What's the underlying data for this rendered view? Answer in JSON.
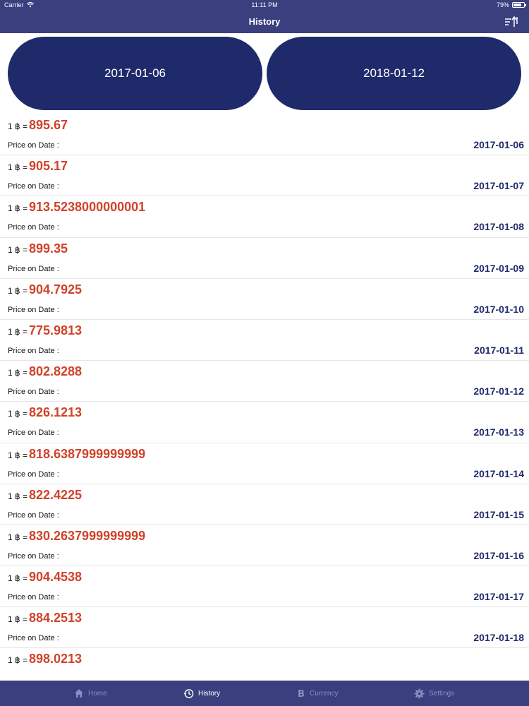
{
  "status_bar": {
    "carrier": "Carrier",
    "time": "11:11 PM",
    "battery": "79%"
  },
  "nav": {
    "title": "History",
    "sort_icon": "sort-icon"
  },
  "date_range": {
    "start": "2017-01-06",
    "end": "2018-01-12"
  },
  "rate_prefix": "1 ฿ =",
  "price_label": "Price on Date :",
  "rows": [
    {
      "value": "895.67",
      "date": "2017-01-06"
    },
    {
      "value": "905.17",
      "date": "2017-01-07"
    },
    {
      "value": "913.5238000000001",
      "date": "2017-01-08"
    },
    {
      "value": "899.35",
      "date": "2017-01-09"
    },
    {
      "value": "904.7925",
      "date": "2017-01-10"
    },
    {
      "value": "775.9813",
      "date": "2017-01-11"
    },
    {
      "value": "802.8288",
      "date": "2017-01-12"
    },
    {
      "value": "826.1213",
      "date": "2017-01-13"
    },
    {
      "value": "818.6387999999999",
      "date": "2017-01-14"
    },
    {
      "value": "822.4225",
      "date": "2017-01-15"
    },
    {
      "value": "830.2637999999999",
      "date": "2017-01-16"
    },
    {
      "value": "904.4538",
      "date": "2017-01-17"
    },
    {
      "value": "884.2513",
      "date": "2017-01-18"
    },
    {
      "value": "898.0213",
      "date": ""
    }
  ],
  "tabs": [
    {
      "label": "Home",
      "icon": "home-icon",
      "active": false
    },
    {
      "label": "History",
      "icon": "history-icon",
      "active": true
    },
    {
      "label": "Currency",
      "icon": "bitcoin-icon",
      "active": false
    },
    {
      "label": "Settings",
      "icon": "gear-icon",
      "active": false
    }
  ],
  "colors": {
    "bar": "#3a3f7e",
    "button": "#1f2a6b",
    "value": "#d0432a",
    "date": "#1f2a6b"
  }
}
